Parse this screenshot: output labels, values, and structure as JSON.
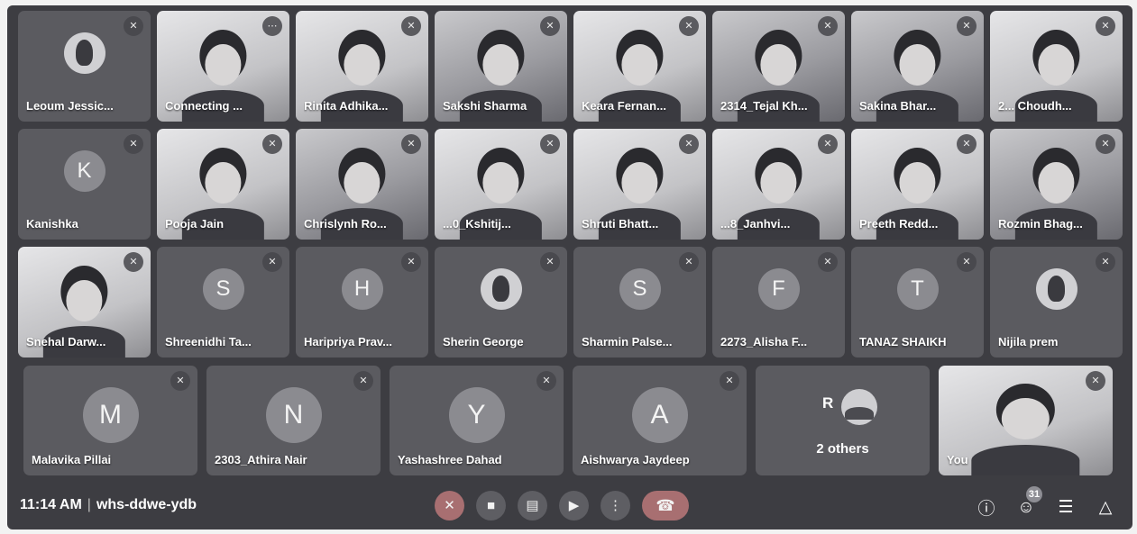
{
  "meeting": {
    "time": "11:14 AM",
    "separator": "|",
    "code": "whs-ddwe-ydb"
  },
  "participants_row1": [
    {
      "name": "Leoum Jessic...",
      "kind": "photo-avatar"
    },
    {
      "name": "Connecting ...",
      "kind": "video"
    },
    {
      "name": "Rinita Adhika...",
      "kind": "video"
    },
    {
      "name": "Sakshi Sharma",
      "kind": "video"
    },
    {
      "name": "Keara Fernan...",
      "kind": "video"
    },
    {
      "name": "2314_Tejal Kh...",
      "kind": "video"
    },
    {
      "name": "Sakina Bhar...",
      "kind": "video"
    },
    {
      "name": "2... Choudh...",
      "kind": "video"
    }
  ],
  "participants_row2": [
    {
      "name": "Kanishka",
      "kind": "avatar",
      "initial": "K"
    },
    {
      "name": "Pooja Jain",
      "kind": "video"
    },
    {
      "name": "Chrislynh Ro...",
      "kind": "video"
    },
    {
      "name": "...0_Kshitij...",
      "kind": "video"
    },
    {
      "name": "Shruti Bhatt...",
      "kind": "video"
    },
    {
      "name": "...8_Janhvi...",
      "kind": "video"
    },
    {
      "name": "Preeth Redd...",
      "kind": "video"
    },
    {
      "name": "Rozmin Bhag...",
      "kind": "video"
    }
  ],
  "participants_row3": [
    {
      "name": "Snehal Darw...",
      "kind": "video"
    },
    {
      "name": "Shreenidhi Ta...",
      "kind": "avatar",
      "initial": "S"
    },
    {
      "name": "Haripriya Prav...",
      "kind": "avatar",
      "initial": "H"
    },
    {
      "name": "Sherin George",
      "kind": "photo-avatar"
    },
    {
      "name": "Sharmin Palse...",
      "kind": "avatar",
      "initial": "S"
    },
    {
      "name": "2273_Alisha F...",
      "kind": "avatar",
      "initial": "F"
    },
    {
      "name": "TANAZ SHAIKH",
      "kind": "avatar",
      "initial": "T"
    },
    {
      "name": "Nijila prem",
      "kind": "photo-avatar"
    }
  ],
  "participants_row4": [
    {
      "name": "Malavika Pillai",
      "kind": "avatar",
      "initial": "M"
    },
    {
      "name": "2303_Athira Nair",
      "kind": "avatar",
      "initial": "N"
    },
    {
      "name": "Yashashree Dahad",
      "kind": "avatar",
      "initial": "Y"
    },
    {
      "name": "Aishwarya Jaydeep",
      "kind": "avatar",
      "initial": "A"
    }
  ],
  "others_tile": {
    "initial": "R",
    "label": "2 others"
  },
  "self_tile": {
    "name": "You"
  },
  "controls": {
    "mic": "mic-off-icon",
    "camera": "camera-icon",
    "captions": "captions-icon",
    "present": "present-icon",
    "more": "more-options-icon",
    "end": "end-call-icon"
  },
  "people_count": "31",
  "colors": {
    "background": "#3d3d42",
    "tile": "#5b5b60",
    "end_call": "#a86f71"
  }
}
